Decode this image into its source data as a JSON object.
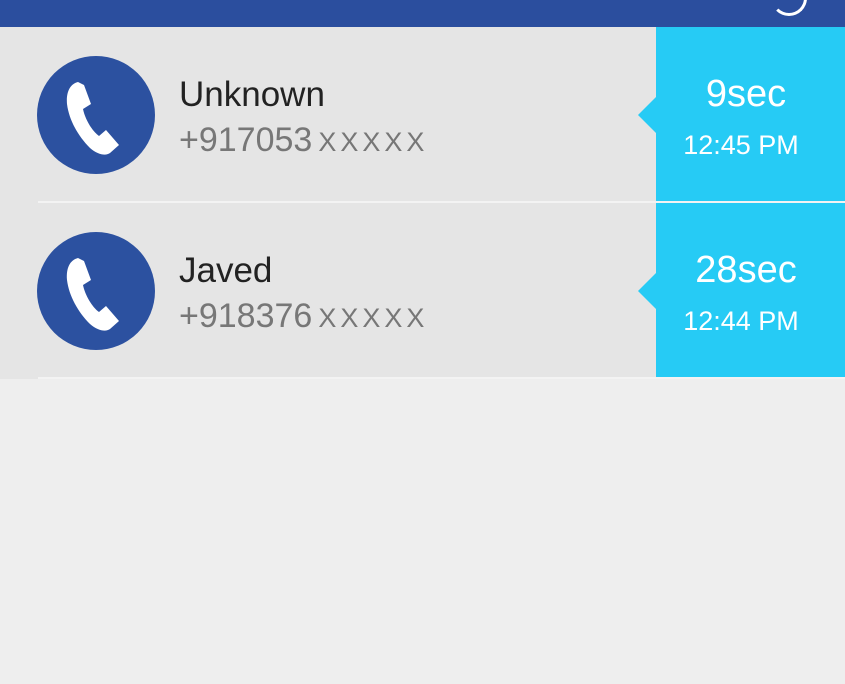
{
  "app_bar": {
    "color": "#2b4e9e",
    "icon": "circle-arrow-icon"
  },
  "colors": {
    "avatar_bg": "#2c51a0",
    "duration_panel": "#26cbf5",
    "row_bg": "#e5e5e5",
    "page_bg": "#eeeeee"
  },
  "calls": [
    {
      "name": "Unknown",
      "number_prefix": "+917053",
      "number_masked": "XXXXX",
      "duration": "9sec",
      "time": "12:45 PM",
      "icon": "phone-icon"
    },
    {
      "name": "Javed",
      "number_prefix": "+918376",
      "number_masked": "XXXXX",
      "duration": "28sec",
      "time": "12:44 PM",
      "icon": "phone-icon"
    }
  ]
}
